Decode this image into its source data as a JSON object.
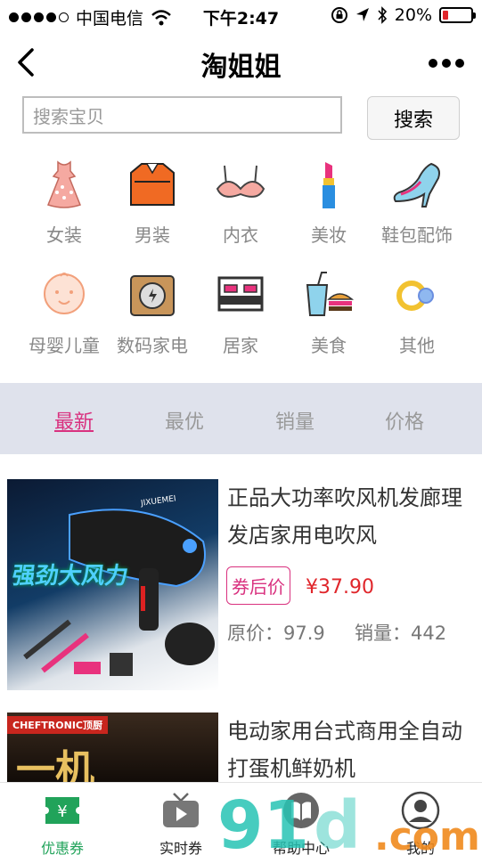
{
  "status_bar": {
    "carrier": "中国电信",
    "time": "下午2:47",
    "battery": "20%",
    "battery_level": 0.2,
    "icons": [
      "signal-dots",
      "wifi-icon",
      "orientation-lock-icon",
      "location-icon",
      "bluetooth-icon",
      "battery-icon"
    ]
  },
  "nav": {
    "title": "淘姐姐",
    "back_icon": "chevron-left-icon",
    "more_icon": "more-dots-icon"
  },
  "search": {
    "placeholder": "搜索宝贝",
    "button": "搜索"
  },
  "categories": [
    {
      "label": "女装",
      "icon": "dress-icon"
    },
    {
      "label": "男装",
      "icon": "shirt-icon"
    },
    {
      "label": "内衣",
      "icon": "bra-icon"
    },
    {
      "label": "美妆",
      "icon": "lipstick-icon"
    },
    {
      "label": "鞋包配饰",
      "icon": "high-heel-icon"
    },
    {
      "label": "母婴儿童",
      "icon": "baby-icon"
    },
    {
      "label": "数码家电",
      "icon": "camera-icon"
    },
    {
      "label": "居家",
      "icon": "bed-icon"
    },
    {
      "label": "美食",
      "icon": "food-icon"
    },
    {
      "label": "其他",
      "icon": "rings-icon"
    }
  ],
  "sort_tabs": [
    {
      "label": "最新",
      "active": true
    },
    {
      "label": "最优",
      "active": false
    },
    {
      "label": "销量",
      "active": false
    },
    {
      "label": "价格",
      "active": false
    }
  ],
  "products": [
    {
      "title": "正品大功率吹风机发廊理发店家用电吹风",
      "coupon_tag": "券后价",
      "coupon_price": "¥37.90",
      "original_price": "原价：97.9",
      "sales": "销量：442",
      "image_text": "强劲大风力",
      "image_brand": "JIXUEMEI"
    },
    {
      "title": "电动家用台式商用全自动打蛋机鲜奶机",
      "image_brand": "CHEFTRONIC顶厨",
      "image_text": "一机"
    }
  ],
  "tab_bar": [
    {
      "label": "优惠券",
      "icon": "coupon-icon",
      "active": true
    },
    {
      "label": "实时券",
      "icon": "tv-play-icon",
      "active": false
    },
    {
      "label": "帮助中心",
      "icon": "book-icon",
      "active": false
    },
    {
      "label": "我的",
      "icon": "user-icon",
      "active": false
    }
  ],
  "colors": {
    "accent": "#d9317f",
    "price": "#e0262b",
    "tab_active": "#21a35a",
    "sort_bg": "#dfe2ec"
  }
}
